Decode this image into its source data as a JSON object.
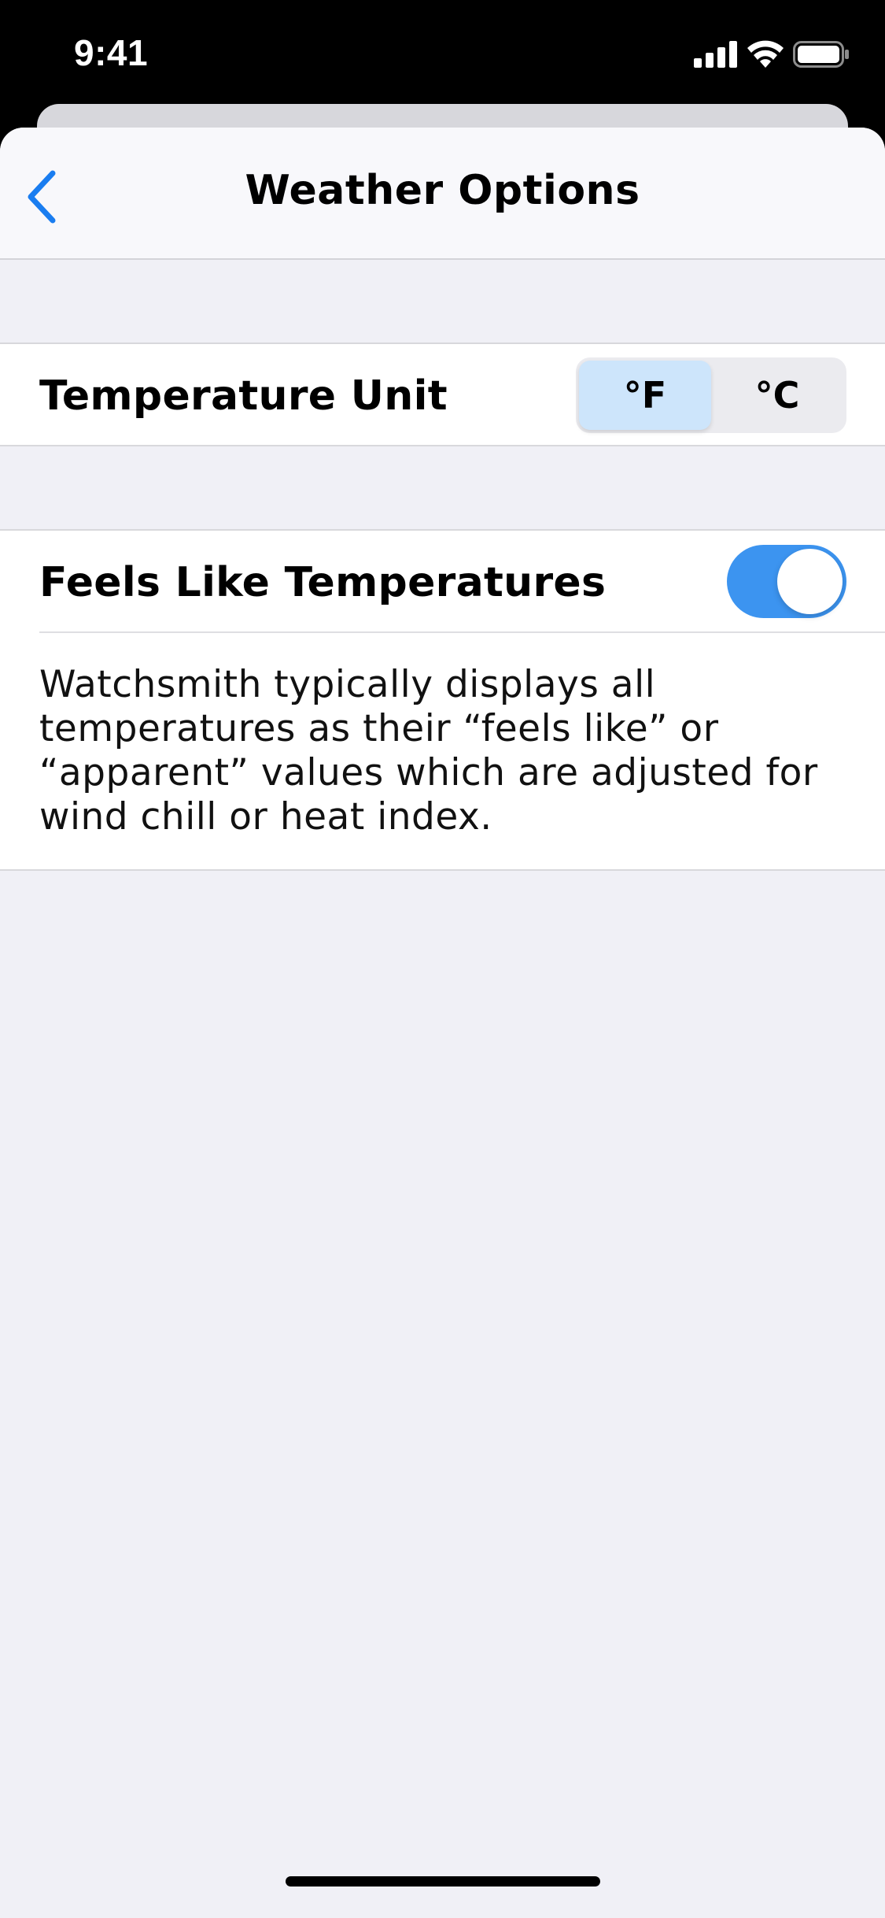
{
  "status_bar": {
    "time": "9:41"
  },
  "nav": {
    "title": "Weather Options",
    "back_icon": "chevron-left-icon"
  },
  "temperature_unit": {
    "label": "Temperature Unit",
    "options": [
      "°F",
      "°C"
    ],
    "selected": "°F"
  },
  "feels_like": {
    "label": "Feels Like Temperatures",
    "enabled": true,
    "description": "Watchsmith typically displays all temperatures as their “feels like” or “apparent” values which are adjusted for wind chill or heat index."
  },
  "colors": {
    "accent": "#3c94f0",
    "selected_segment": "#cde5fb",
    "background": "#f0f0f6"
  }
}
